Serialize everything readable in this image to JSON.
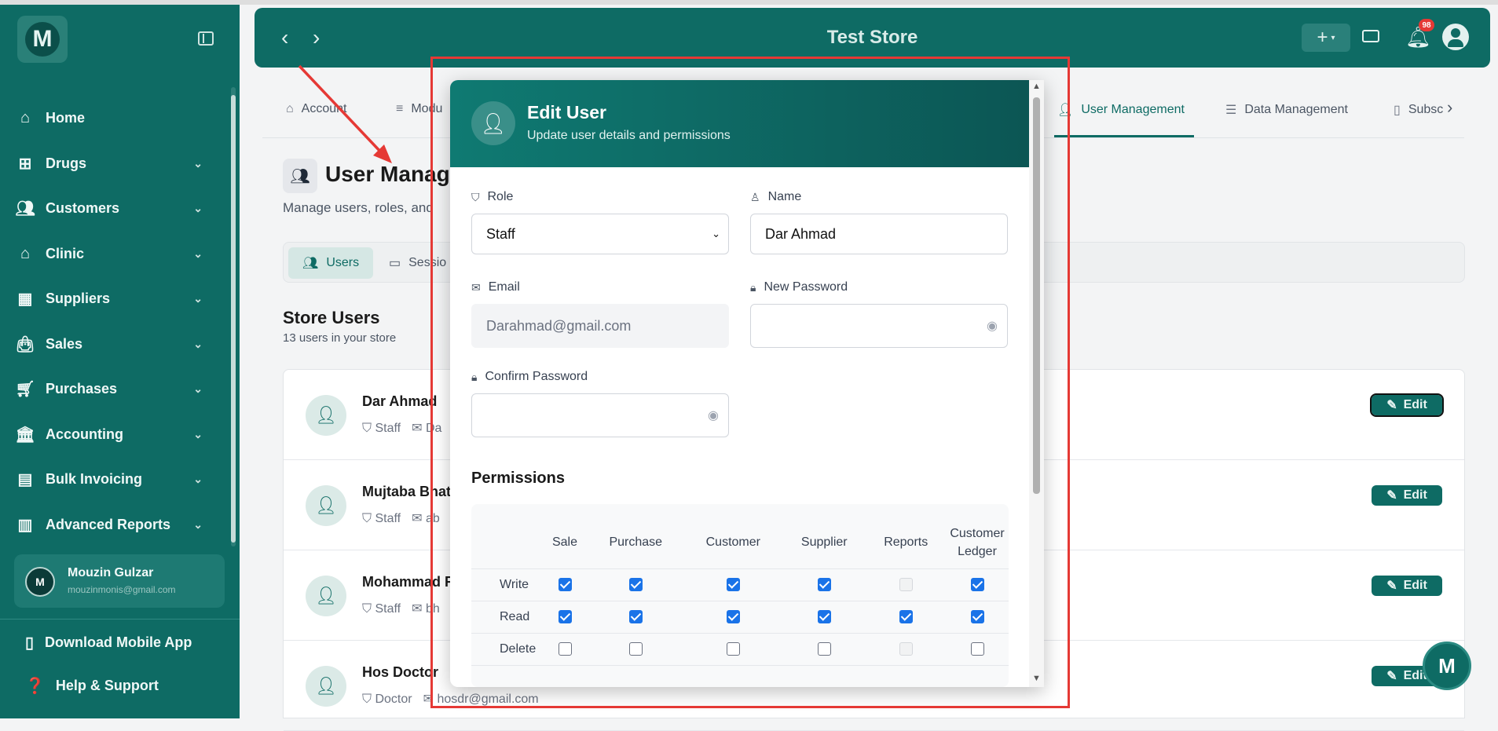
{
  "header": {
    "title": "Test Store",
    "notifications_count": "98"
  },
  "logo_letter": "M",
  "sidebar": {
    "items": [
      {
        "label": "Home",
        "icon": "home-icon"
      },
      {
        "label": "Drugs",
        "icon": "drugs-icon"
      },
      {
        "label": "Customers",
        "icon": "customers-icon"
      },
      {
        "label": "Clinic",
        "icon": "clinic-icon"
      },
      {
        "label": "Suppliers",
        "icon": "suppliers-icon"
      },
      {
        "label": "Sales",
        "icon": "sales-icon"
      },
      {
        "label": "Purchases",
        "icon": "cart-icon"
      },
      {
        "label": "Accounting",
        "icon": "bank-icon"
      },
      {
        "label": "Bulk Invoicing",
        "icon": "invoice-icon"
      },
      {
        "label": "Advanced Reports",
        "icon": "reports-icon"
      }
    ],
    "user": {
      "initial": "M",
      "name": "Mouzin Gulzar",
      "email": "mouzinmonis@gmail.com"
    },
    "download_label": "Download Mobile App",
    "help_label": "Help & Support"
  },
  "tabs": [
    "Account",
    "Modu",
    "User Management",
    "Data Management",
    "Subsc"
  ],
  "page": {
    "title": "User Manag",
    "subtitle": "Manage users, roles, and",
    "subtabs": [
      "Users",
      "Sessio"
    ],
    "store_users_title": "Store Users",
    "store_users_sub": "13 users in your store",
    "edit_label": "Edit"
  },
  "users": [
    {
      "name": "Dar Ahmad",
      "role": "Staff",
      "email": "Da"
    },
    {
      "name": "Mujtaba Bhat",
      "role": "Staff",
      "email": "ab"
    },
    {
      "name": "Mohammad R",
      "role": "Staff",
      "email": "bh"
    },
    {
      "name": "Hos Doctor",
      "role": "Doctor",
      "email": "hosdr@gmail.com"
    }
  ],
  "modal": {
    "title": "Edit User",
    "subtitle": "Update user details and permissions",
    "role_label": "Role",
    "role_value": "Staff",
    "name_label": "Name",
    "name_value": "Dar Ahmad",
    "email_label": "Email",
    "email_value": "Darahmad@gmail.com",
    "new_password_label": "New Password",
    "confirm_password_label": "Confirm Password",
    "permissions_title": "Permissions",
    "columns": [
      "Sale",
      "Purchase",
      "Customer",
      "Supplier",
      "Reports",
      "Customer Ledger"
    ],
    "rows": [
      {
        "label": "Write",
        "values": [
          "on",
          "on",
          "on",
          "on",
          "disabled",
          "on"
        ]
      },
      {
        "label": "Read",
        "values": [
          "on",
          "on",
          "on",
          "on",
          "on",
          "on"
        ]
      },
      {
        "label": "Delete",
        "values": [
          "off",
          "off",
          "off",
          "off",
          "disabled",
          "off"
        ]
      }
    ]
  },
  "colors": {
    "brand": "#0e6b64",
    "annotation": "#e53935",
    "checkbox": "#1a73e8"
  }
}
